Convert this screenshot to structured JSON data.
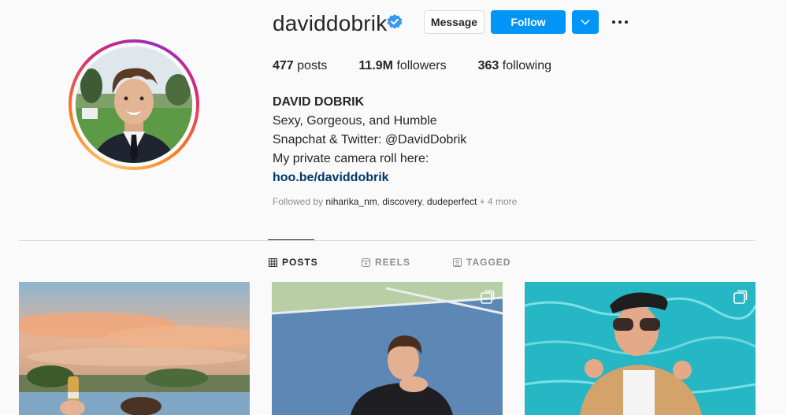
{
  "profile": {
    "username": "daviddobrik",
    "message_label": "Message",
    "follow_label": "Follow"
  },
  "stats": {
    "posts_count": "477",
    "posts_label": "posts",
    "followers_count": "11.9M",
    "followers_label": "followers",
    "following_count": "363",
    "following_label": "following"
  },
  "bio": {
    "name": "DAVID DOBRIK",
    "line1": "Sexy, Gorgeous, and Humble",
    "line2": "Snapchat & Twitter: @DavidDobrik",
    "line3": "My private camera roll here:",
    "link": "hoo.be/daviddobrik"
  },
  "followed_by": {
    "prefix": "Followed by",
    "accounts": [
      "niharika_nm",
      "discovery",
      "dudeperfect"
    ],
    "more": "+ 4 more"
  },
  "tabs": [
    {
      "label": "POSTS",
      "icon": "grid-icon",
      "active": true
    },
    {
      "label": "REELS",
      "icon": "reels-icon",
      "active": false
    },
    {
      "label": "TAGGED",
      "icon": "tagged-icon",
      "active": false
    }
  ],
  "colors": {
    "accent": "#0095f6",
    "link": "#00376b",
    "verified": "#3897f0"
  }
}
